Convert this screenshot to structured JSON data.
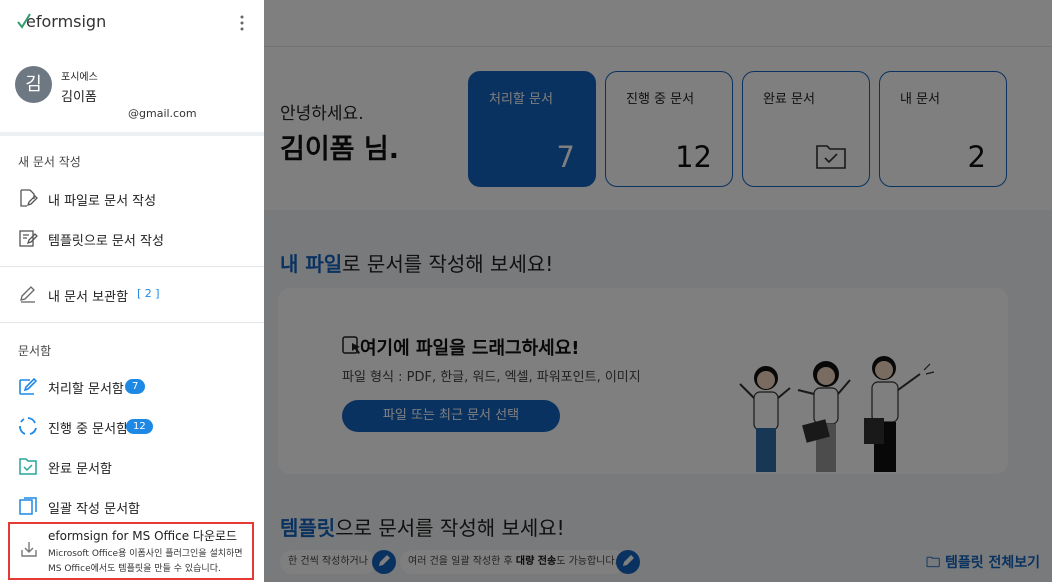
{
  "sidebar": {
    "brand": "eformsign",
    "user": {
      "avatar_initial": "김",
      "company": "포시에스",
      "name": "김이폼",
      "email": "@gmail.com"
    },
    "new_doc_group": "새 문서 작성",
    "new_doc_items": [
      {
        "label": "내 파일로 문서 작성",
        "icon": "file-edit-icon"
      },
      {
        "label": "템플릿으로 문서 작성",
        "icon": "template-edit-icon"
      }
    ],
    "storage": {
      "label": "내 문서 보관함",
      "count": "[ 2 ]"
    },
    "inbox_group": "문서함",
    "inbox_items": [
      {
        "label": "처리할 문서함",
        "badge": "7",
        "icon": "edit-doc-icon"
      },
      {
        "label": "진행 중 문서함",
        "badge": "12",
        "icon": "progress-icon"
      },
      {
        "label": "완료 문서함",
        "icon": "check-folder-icon"
      },
      {
        "label": "일괄 작성 문서함",
        "icon": "bulk-doc-icon"
      }
    ],
    "office_promo": {
      "title": "eformsign for MS Office 다운로드",
      "line1": "Microsoft Office용 이폼사인 플러그인을 설치하면",
      "line2": "MS Office에서도 템플릿을 만들 수 있습니다."
    }
  },
  "main": {
    "greeting": "안녕하세요.",
    "greeting_name": "김이폼 님.",
    "cards": [
      {
        "label": "처리할 문서",
        "value": "7"
      },
      {
        "label": "진행 중 문서",
        "value": "12"
      },
      {
        "label": "완료 문서",
        "value": ""
      },
      {
        "label": "내 문서",
        "value": "2"
      }
    ],
    "myfile_section": {
      "highlight": "내 파일",
      "rest": "로 문서를 작성해 보세요!"
    },
    "dropzone": {
      "title": "여기에 파일을 드래그하세요!",
      "formats": "파일 형식 : PDF, 한글, 워드, 엑셀, 파워포인트, 이미지",
      "button": "파일 또는 최근 문서 선택"
    },
    "template_section": {
      "highlight": "템플릿",
      "rest": "으로 문서를 작성해 보세요!"
    },
    "template_bar": {
      "pill1": "한 건씩 작성하거나",
      "pill2_pre": "여러 건을 일괄 작성한 후 ",
      "pill2_bold": "대량 전송",
      "pill2_post": "도 가능합니다.",
      "view_all": "템플릿 전체보기"
    }
  },
  "colors": {
    "accent": "#1565c0",
    "badge": "#1e88e5",
    "highlight_border": "#e53935"
  }
}
